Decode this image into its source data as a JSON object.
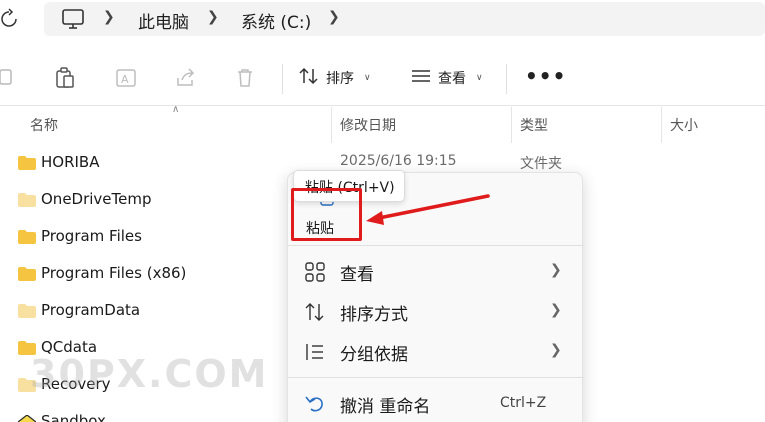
{
  "address": {
    "icon": "refresh-icon",
    "pc_icon": "computer-icon",
    "crumbs": [
      "此电脑",
      "系统 (C:)"
    ]
  },
  "toolbar": {
    "icons": [
      "copy-icon",
      "paste-icon",
      "rename-icon",
      "share-icon",
      "delete-icon"
    ],
    "sort_label": "排序",
    "view_label": "查看",
    "more_label": "•••"
  },
  "columns": {
    "name": "名称",
    "date": "修改日期",
    "type": "类型",
    "size": "大小"
  },
  "files": [
    {
      "name": "HORIBA",
      "date": "2025/6/16 19:15",
      "type": "文件夹"
    },
    {
      "name": "OneDriveTemp",
      "date": "",
      "type": ""
    },
    {
      "name": "Program Files",
      "date": "",
      "type": ""
    },
    {
      "name": "Program Files (x86)",
      "date": "",
      "type": ""
    },
    {
      "name": "ProgramData",
      "date": "",
      "type": ""
    },
    {
      "name": "QCdata",
      "date": "",
      "type": ""
    },
    {
      "name": "Recovery",
      "date": "",
      "type": ""
    },
    {
      "name": "Sandbox",
      "date": "",
      "type": ""
    }
  ],
  "context_menu": {
    "paste_label": "粘贴",
    "tooltip": "粘贴 (Ctrl+V)",
    "items": [
      {
        "icon": "grid-view-icon",
        "label": "查看",
        "has_submenu": true
      },
      {
        "icon": "sort-arrows-icon",
        "label": "排序方式",
        "has_submenu": true
      },
      {
        "icon": "group-list-icon",
        "label": "分组依据",
        "has_submenu": true
      },
      {
        "icon": "undo-icon",
        "label": "撤消 重命名",
        "shortcut": "Ctrl+Z"
      }
    ]
  },
  "watermark": "30PX.COM",
  "colors": {
    "annotation_red": "#e01b1b",
    "folder_yellow": "#f5c542",
    "accent_blue": "#2b6fc4"
  }
}
